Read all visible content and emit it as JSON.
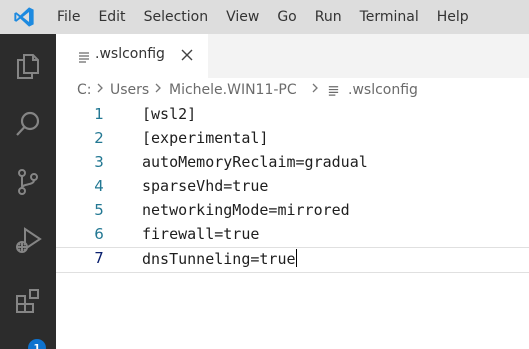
{
  "menu": {
    "items": [
      "File",
      "Edit",
      "Selection",
      "View",
      "Go",
      "Run",
      "Terminal",
      "Help"
    ]
  },
  "activity_bar": {
    "icons": [
      "explorer-icon",
      "search-icon",
      "source-control-icon",
      "run-debug-icon",
      "extensions-icon"
    ],
    "extensions_badge": "1"
  },
  "tab": {
    "label": ".wslconfig",
    "close_icon": "close-icon"
  },
  "breadcrumb": {
    "parts": [
      "C:",
      "Users",
      "Michele.WIN11-PC",
      ".wslconfig"
    ]
  },
  "editor": {
    "lines": [
      {
        "number": "1",
        "text": "[wsl2]"
      },
      {
        "number": "2",
        "text": "[experimental]"
      },
      {
        "number": "3",
        "text": "autoMemoryReclaim=gradual"
      },
      {
        "number": "4",
        "text": "sparseVhd=true"
      },
      {
        "number": "5",
        "text": "networkingMode=mirrored"
      },
      {
        "number": "6",
        "text": "firewall=true"
      },
      {
        "number": "7",
        "text": "dnsTunneling=true"
      }
    ]
  },
  "colors": {
    "accent": "#0e72cf",
    "activity_bar_bg": "#2c2c2c",
    "menu_bg": "#dddddd",
    "line_number": "#237893"
  }
}
